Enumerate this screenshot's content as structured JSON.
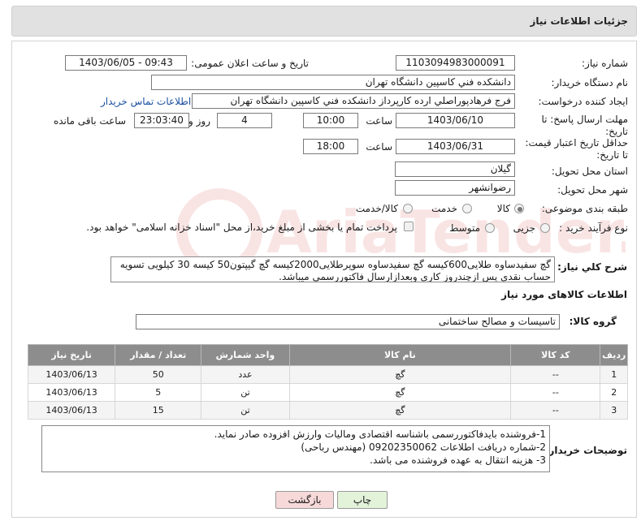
{
  "header": {
    "title": "جزئیات اطلاعات نیاز"
  },
  "form": {
    "need_number_label": "شماره نیاز:",
    "need_number": "1103094983000091",
    "announce_label": "تاریخ و ساعت اعلان عمومی:",
    "announce_value": "1403/06/05 - 09:43",
    "buyer_org_label": "نام دستگاه خریدار:",
    "buyer_org": "دانشکده فني کاسپين دانشگاه تهران",
    "requester_label": "ایجاد کننده درخواست:",
    "requester": "فرج فرهادپوراصلي ارده کارپرداز دانشکده فني کاسپين دانشگاه تهران",
    "contact_link": "اطلاعات تماس خریدار",
    "reply_deadline_label": "مهلت ارسال پاسخ: تا تاریخ:",
    "reply_date": "1403/06/10",
    "time_label": "ساعت",
    "reply_time": "10:00",
    "days_value": "4",
    "days_label": "روز و",
    "remaining_time": "23:03:40",
    "remaining_label": "ساعت باقی مانده",
    "price_validity_label": "حداقل تاریخ اعتبار قیمت: تا تاریخ:",
    "price_date": "1403/06/31",
    "price_time": "18:00",
    "province_label": "استان محل تحویل:",
    "province": "گیلان",
    "city_label": "شهر محل تحویل:",
    "city": "رضوانشهر",
    "category_label": "طبقه بندی موضوعی:",
    "category_options": [
      "کالا",
      "خدمت",
      "کالا/خدمت"
    ],
    "process_label": "نوع فرآیند خرید :",
    "process_options": [
      "جزیی",
      "متوسط"
    ],
    "payment_note": "پرداخت تمام یا بخشی از مبلغ خرید،از محل \"اسناد خزانه اسلامی\" خواهد بود."
  },
  "description": {
    "label": "شرح کلي نياز:",
    "text": "گچ سفیدساوه طلایی600کیسه گچ سفیدساوه سوپرطلایی2000کیسه گچ گیپتون50 کیسه 30 کیلویی تسویه حساب نقدی پس ازچندروز کاری وبعدازارسال فاکتوررسمی میباشد."
  },
  "goods": {
    "section_title": "اطلاعات کالاهای مورد نیاز",
    "group_label": "گروه کالا:",
    "group_value": "تاسیسات و مصالح ساختمانی",
    "columns": [
      "ردیف",
      "کد کالا",
      "نام کالا",
      "واحد شمارش",
      "تعداد / مقدار",
      "تاریخ نیاز"
    ],
    "rows": [
      [
        "1",
        "--",
        "گچ",
        "عدد",
        "50",
        "1403/06/13"
      ],
      [
        "2",
        "--",
        "گچ",
        "تن",
        "5",
        "1403/06/13"
      ],
      [
        "3",
        "--",
        "گچ",
        "تن",
        "15",
        "1403/06/13"
      ]
    ]
  },
  "buyer_notes": {
    "label": "توضیحات خریدار:",
    "lines": [
      "1-فروشنده بایدفاکتوررسمی باشناسه اقتصادی ومالیات وارزش افزوده صادر نماید.",
      "2-شماره دریافت اطلاعات 09202350062 (مهندس رباحی)",
      "3- هزینه انتقال به عهده فروشنده می باشد."
    ]
  },
  "buttons": {
    "print": "چاپ",
    "back": "بازگشت"
  },
  "colors": {
    "header_bg": "#e1e1e1",
    "table_header": "#8d8d8d",
    "print_btn": "#e3f3da",
    "back_btn": "#f7d9d9",
    "link": "#1a4fa0"
  }
}
